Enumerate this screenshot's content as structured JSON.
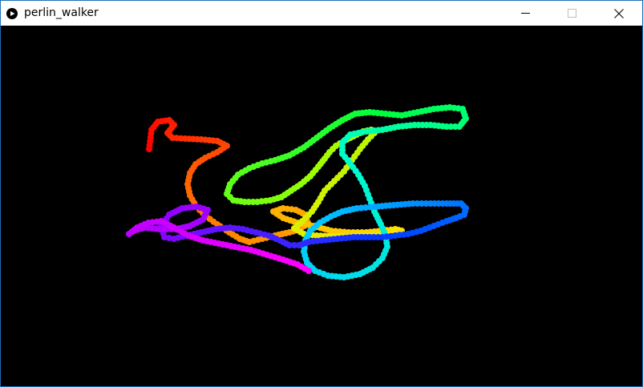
{
  "window": {
    "title": "perlin_walker",
    "background": "#000000"
  },
  "titlebar": {
    "icon": "play-circle-icon",
    "minimize_icon": "minimize-icon",
    "maximize_icon": "maximize-icon",
    "close_icon": "close-icon"
  },
  "sketch": {
    "description_colors": [
      "#ff0000",
      "#ff8000",
      "#ffff00",
      "#80ff00",
      "#00ff40",
      "#00ffc0",
      "#00c0ff",
      "#0040ff",
      "#8000ff",
      "#ff00ff"
    ]
  }
}
